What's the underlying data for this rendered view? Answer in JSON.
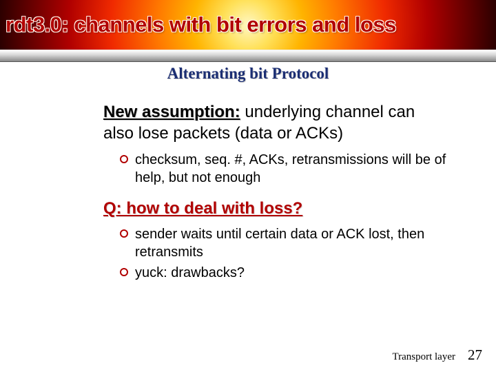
{
  "title": {
    "prefix": "rdt3.0",
    "rest": ": channels with bit errors and loss"
  },
  "subtitle": "Alternating bit Protocol",
  "assumption": {
    "label": "New assumption:",
    "text": " underlying channel can also lose packets (data or ACKs)",
    "bullets": [
      "checksum, seq. #, ACKs, retransmissions will be of help, but not enough"
    ]
  },
  "question": {
    "text": "Q: how to deal with loss?",
    "bullets": [
      "sender waits until certain data or ACK lost, then retransmits",
      "yuck: drawbacks?"
    ]
  },
  "footer": {
    "label": "Transport layer",
    "page": "27"
  }
}
